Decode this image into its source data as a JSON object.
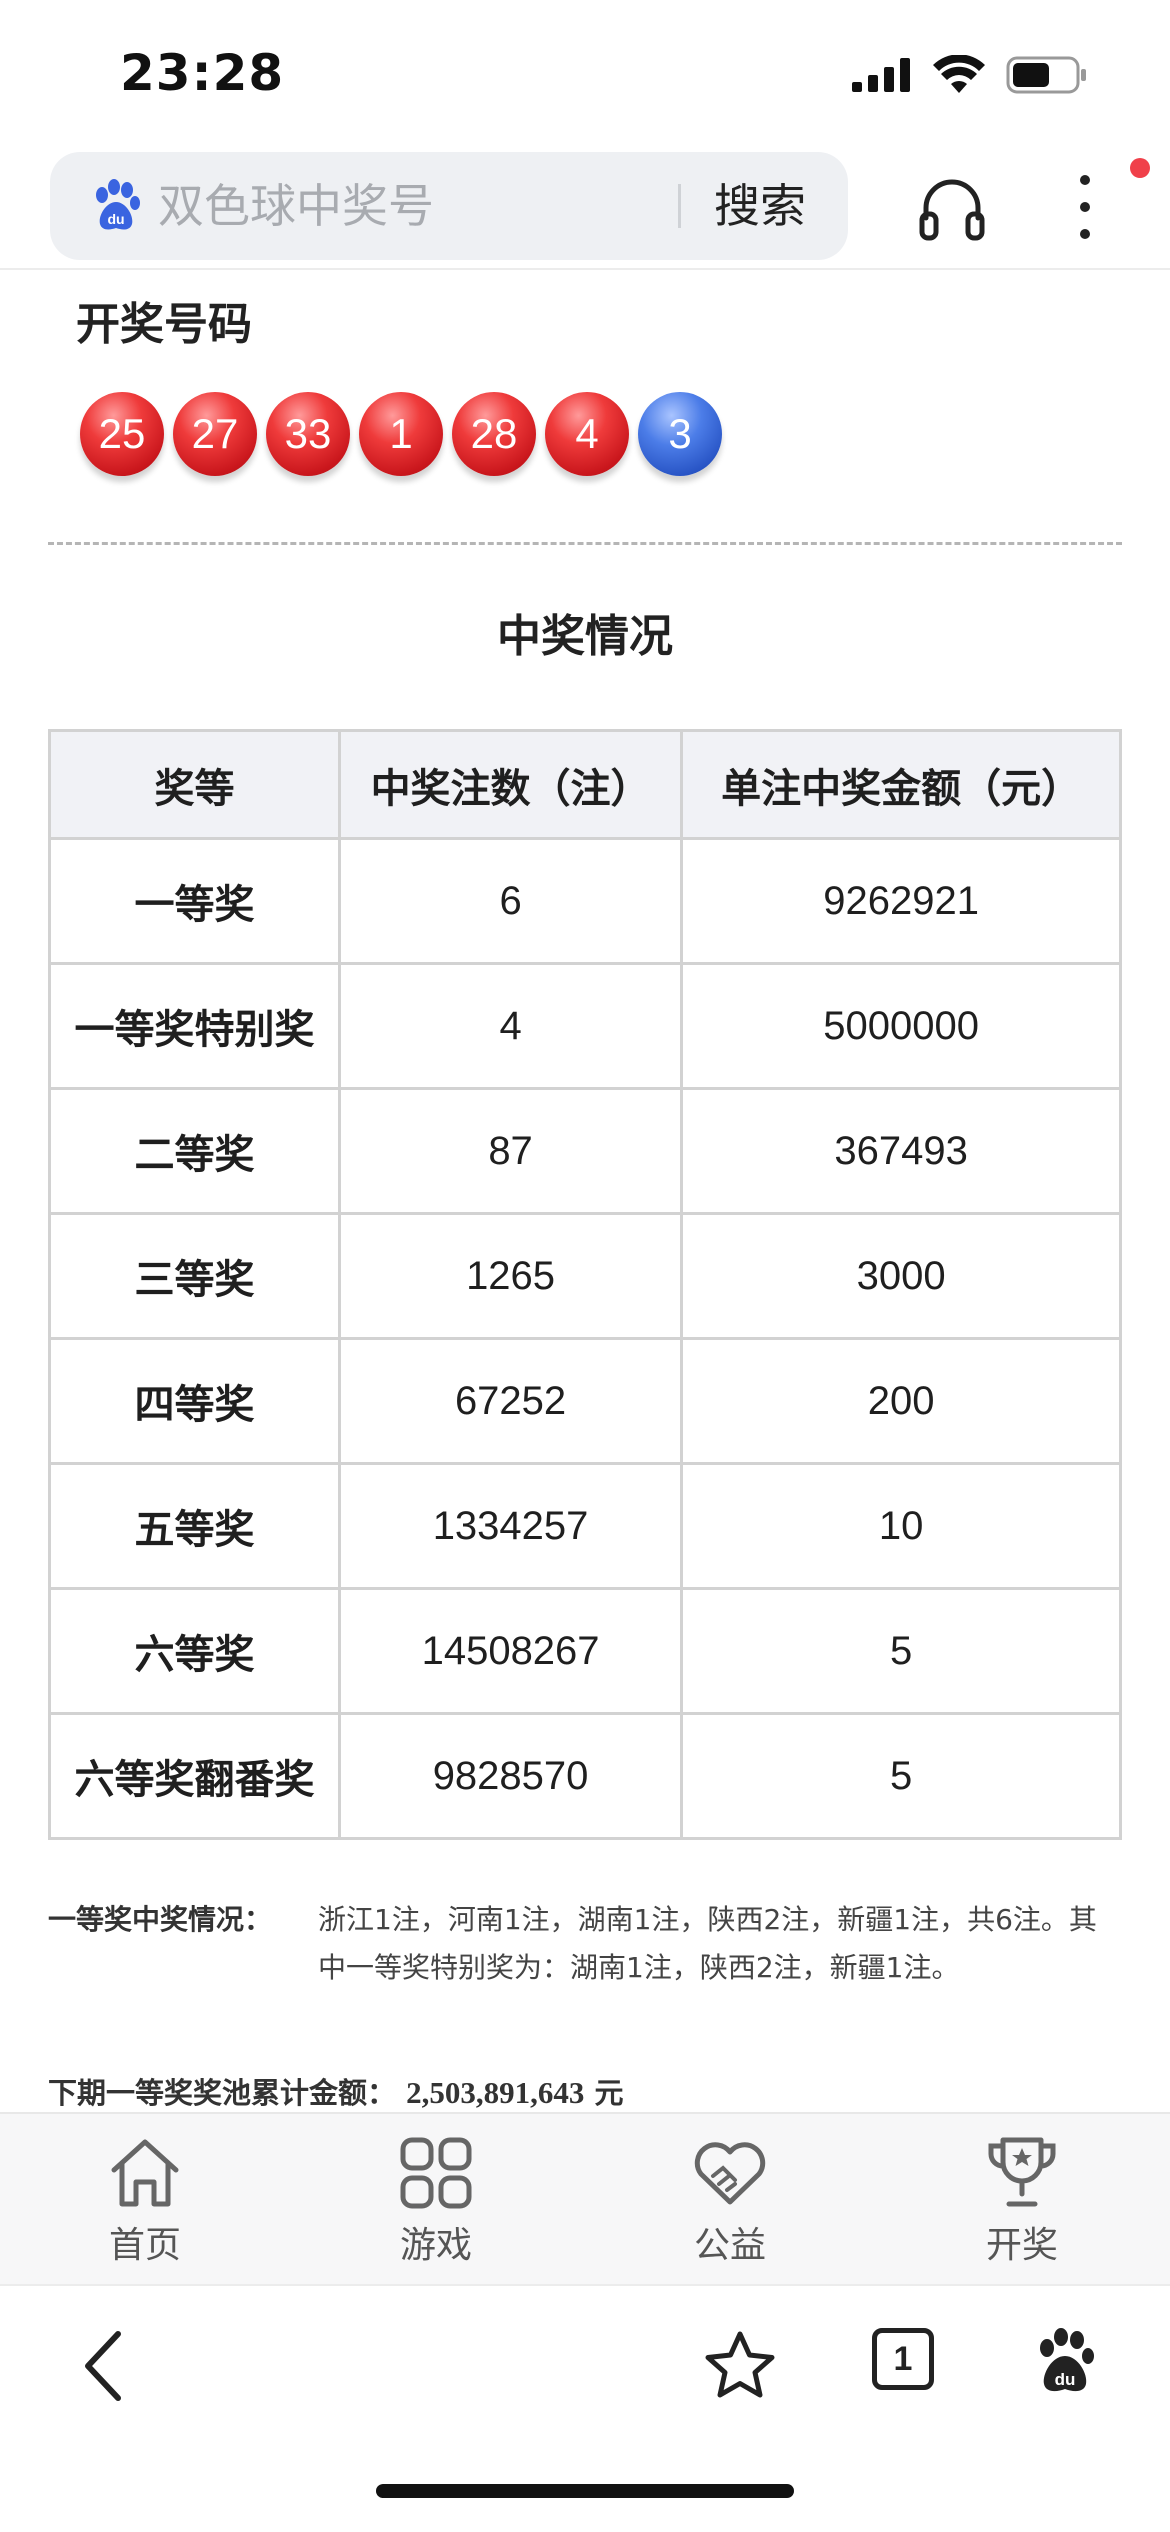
{
  "status_bar": {
    "time": "23:28"
  },
  "search": {
    "query": "双色球中奖号",
    "button_label": "搜索"
  },
  "icons": {
    "search_logo": "baidu-paw-icon",
    "listen": "headphone-icon",
    "more": "more-vertical-icon"
  },
  "draw": {
    "title": "开奖号码",
    "red_balls": [
      "25",
      "27",
      "33",
      "1",
      "28",
      "4"
    ],
    "blue_balls": [
      "3"
    ]
  },
  "prize_section": {
    "title": "中奖情况",
    "headers": [
      "奖等",
      "中奖注数（注）",
      "单注中奖金额（元）"
    ],
    "rows": [
      {
        "level": "一等奖",
        "count": "6",
        "amount": "9262921"
      },
      {
        "level": "一等奖特别奖",
        "count": "4",
        "amount": "5000000"
      },
      {
        "level": "二等奖",
        "count": "87",
        "amount": "367493"
      },
      {
        "level": "三等奖",
        "count": "1265",
        "amount": "3000"
      },
      {
        "level": "四等奖",
        "count": "67252",
        "amount": "200"
      },
      {
        "level": "五等奖",
        "count": "1334257",
        "amount": "10"
      },
      {
        "level": "六等奖",
        "count": "14508267",
        "amount": "5"
      },
      {
        "level": "六等奖翻番奖",
        "count": "9828570",
        "amount": "5"
      }
    ]
  },
  "notes": {
    "first_prize_label": "一等奖中奖情况：",
    "first_prize_text": "浙江1注，河南1注，湖南1注，陕西2注，新疆1注，共6注。其中一等奖特别奖为：湖南1注，陕西2注，新疆1注。",
    "pool_label": "下期一等奖奖池累计金额：",
    "pool_value": "2,503,891,643",
    "pool_unit": "元"
  },
  "bottom_nav": {
    "items": [
      {
        "label": "首页",
        "icon": "home-icon"
      },
      {
        "label": "游戏",
        "icon": "grid-icon"
      },
      {
        "label": "公益",
        "icon": "heart-hands-icon"
      },
      {
        "label": "开奖",
        "icon": "trophy-icon"
      }
    ]
  },
  "browser_toolbar": {
    "tab_count": "1",
    "icons": [
      "back-icon",
      "star-icon",
      "tabs-icon",
      "baidu-du-icon"
    ]
  },
  "colors": {
    "red_ball": "#d9232a",
    "blue_ball": "#3563d6",
    "table_header_bg": "#f1f2f6",
    "border": "#d2d2d2"
  }
}
